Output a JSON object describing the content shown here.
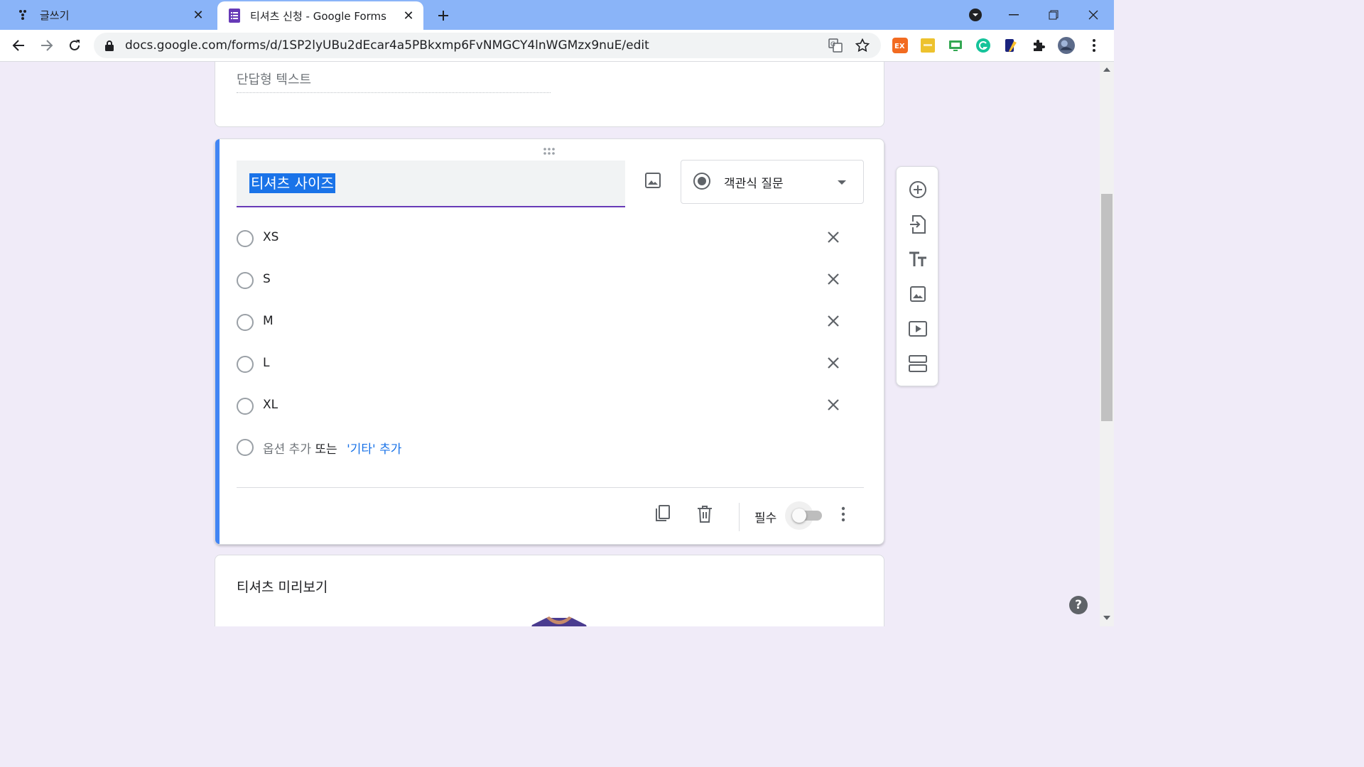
{
  "browser": {
    "tabs": [
      {
        "title": "글쓰기",
        "favicon": "dots-app-icon"
      },
      {
        "title": "티셔츠 신청 - Google Forms",
        "favicon": "google-forms-icon",
        "active": true
      }
    ],
    "url": "docs.google.com/forms/d/1SP2lyUBu2dEcar4a5PBkxmp6FvNMGCY4lnWGMzx9nuE/edit"
  },
  "form": {
    "short_answer_placeholder": "단답형 텍스트",
    "question": {
      "title": "티셔츠 사이즈",
      "type_label": "객관식 질문",
      "options": [
        "XS",
        "S",
        "M",
        "L",
        "XL"
      ],
      "add_option_label": "옵션 추가",
      "or_label": "또는",
      "add_other_label": "'기타' 추가",
      "required_label": "필수",
      "required": false
    },
    "next_card_title": "티셔츠 미리보기"
  },
  "help_label": "?",
  "colors": {
    "accent": "#4285f4",
    "underline": "#673ab7",
    "link": "#1a73e8",
    "tabstrip": "#8ab4f8"
  }
}
